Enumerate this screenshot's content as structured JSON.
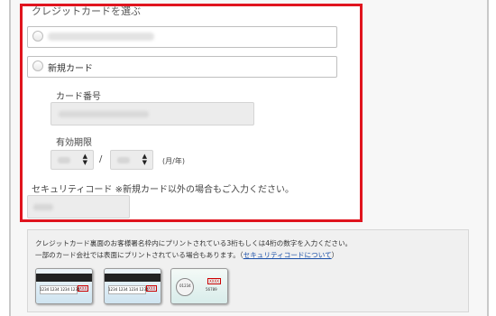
{
  "card_select": {
    "title": "クレジットカードを選ぶ",
    "new_card_label": "新規カード"
  },
  "card_number": {
    "label": "カード番号"
  },
  "expiry": {
    "label": "有効期限",
    "separator": "/",
    "format_hint": "(月/年)"
  },
  "security_code": {
    "label": "セキュリティコード ※新規カード以外の場合もご入力ください。"
  },
  "info": {
    "line1": "クレジットカード裏面のお客様署名枠内にプリントされている3桁もしくは4桁の数字を入力ください。",
    "line2": "一部のカード会社では表面にプリントされている場合もあります。（",
    "link": "セキュリティコードについて",
    "line2_end": "）"
  },
  "cards": [
    {
      "number": "1234 1234 1234 1234",
      "code": "XXX"
    },
    {
      "number": "1234 1234 1234 1234",
      "code": "XXX"
    },
    {
      "number": "01234",
      "code": "XXXX",
      "sub": "56789"
    }
  ],
  "colors": {
    "highlight_border": "#e0141e",
    "link": "#1a4fa8"
  }
}
